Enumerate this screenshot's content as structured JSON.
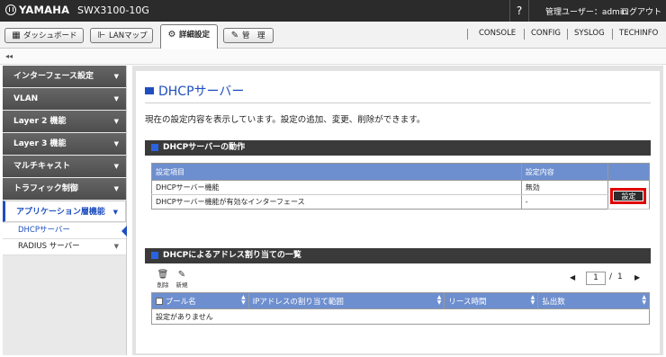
{
  "header": {
    "logo": "YAMAHA",
    "model": "SWX3100-10G",
    "help": "?",
    "user": "管理ユーザー：admin",
    "logout": "ログアウト"
  },
  "nav": {
    "tabs": [
      {
        "label": "ダッシュボード",
        "icon": "dashboard-icon"
      },
      {
        "label": "LANマップ",
        "icon": "lan-map-icon"
      },
      {
        "label": "詳細設定",
        "icon": "gear-icon"
      },
      {
        "label": "管　理",
        "icon": "wrench-icon"
      }
    ],
    "links": [
      "CONSOLE",
      "CONFIG",
      "SYSLOG",
      "TECHINFO"
    ],
    "collapse": "◂◂"
  },
  "sidebar": {
    "menus": [
      {
        "label": "インターフェース設定"
      },
      {
        "label": "VLAN"
      },
      {
        "label": "Layer 2 機能"
      },
      {
        "label": "Layer 3 機能"
      },
      {
        "label": "マルチキャスト"
      },
      {
        "label": "トラフィック制御"
      },
      {
        "label": "アプリケーション層機能"
      }
    ],
    "subitems": [
      {
        "label": "DHCPサーバー"
      },
      {
        "label": "RADIUS サーバー"
      }
    ]
  },
  "main": {
    "title": "DHCPサーバー",
    "description": "現在の設定内容を表示しています。設定の追加、変更、削除ができます。",
    "section1": {
      "title": "DHCPサーバーの動作",
      "headers": [
        "設定項目",
        "設定内容"
      ],
      "rows": [
        {
          "item": "DHCPサーバー機能",
          "value": "無効"
        },
        {
          "item": "DHCPサーバー機能が有効なインターフェース",
          "value": "-"
        }
      ],
      "button": "設定"
    },
    "section2": {
      "title": "DHCPによるアドレス割り当ての一覧",
      "tools": [
        {
          "label": "削除",
          "icon": "trash-icon"
        },
        {
          "label": "新規",
          "icon": "new-edit-icon"
        }
      ],
      "pager": {
        "current": "1",
        "total": "1",
        "separator": "/"
      },
      "headers": [
        "プール名",
        "IPアドレスの割り当て範囲",
        "リース時間",
        "払出数"
      ],
      "empty": "設定がありません"
    }
  }
}
